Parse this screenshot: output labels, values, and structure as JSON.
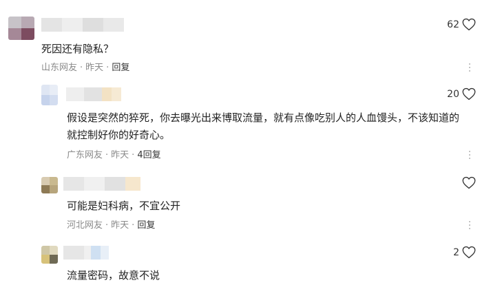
{
  "comments": [
    {
      "text": "死因还有隐私？",
      "meta": {
        "location": "山东网友",
        "time": "昨天",
        "reply": "回复"
      },
      "likes": "62"
    },
    {
      "text": "假设是突然的猝死，你去曝光出来博取流量，就有点像吃别人的人血馒头，不该知道的就控制好你的好奇心。",
      "meta": {
        "location": "广东网友",
        "time": "昨天",
        "reply": "4回复"
      },
      "likes": "20"
    },
    {
      "text": "可能是妇科病，不宜公开",
      "meta": {
        "location": "河北网友",
        "time": "昨天",
        "reply": "回复"
      },
      "likes": ""
    },
    {
      "text": "流量密码，故意不说",
      "meta": {
        "location": "",
        "time": "",
        "reply": ""
      },
      "likes": "2"
    }
  ],
  "icons": {
    "like": "heart-outline-icon",
    "more": "vertical-dots-icon"
  },
  "colors": {
    "meta_gray": "#8a8a8a",
    "text": "#222222",
    "heart_stroke": "#333333"
  }
}
